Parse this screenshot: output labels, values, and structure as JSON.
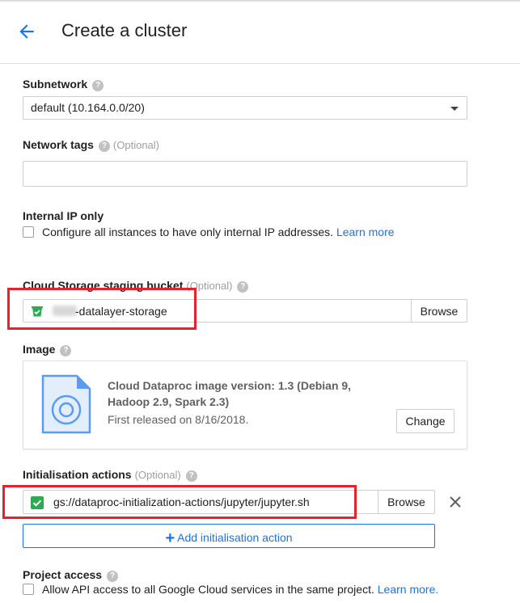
{
  "header": {
    "title": "Create a cluster"
  },
  "subnetwork": {
    "label": "Subnetwork",
    "value": "default (10.164.0.0/20)"
  },
  "network_tags": {
    "label": "Network tags",
    "optional": "(Optional)",
    "value": ""
  },
  "internal_ip": {
    "label": "Internal IP only",
    "checkbox_text": "Configure all instances to have only internal IP addresses.",
    "link": "Learn more",
    "checked": false
  },
  "staging_bucket": {
    "label": "Cloud Storage staging bucket",
    "optional": "(Optional)",
    "value": "-datalayer-storage",
    "browse_label": "Browse"
  },
  "image": {
    "label": "Image",
    "title": "Cloud Dataproc image version: 1.3 (Debian 9, Hadoop 2.9, Spark 2.3)",
    "released": "First released on 8/16/2018.",
    "change_label": "Change"
  },
  "init_actions": {
    "label": "Initialisation actions",
    "optional": "(Optional)",
    "value": "gs://dataproc-initialization-actions/jupyter/jupyter.sh",
    "browse_label": "Browse",
    "add_label": "Add initialisation action"
  },
  "project_access": {
    "label": "Project access",
    "checkbox_text": "Allow API access to all Google Cloud services in the same project.",
    "link": "Learn more.",
    "checked": false
  },
  "colors": {
    "accent": "#1a73e8",
    "highlight": "#e8222a",
    "check": "#2eaa52"
  },
  "icons": {
    "back": "arrow-left-icon",
    "help": "help-icon",
    "bucket": "bucket-icon",
    "image": "disk-image-icon",
    "remove": "close-icon",
    "add": "plus-icon"
  }
}
